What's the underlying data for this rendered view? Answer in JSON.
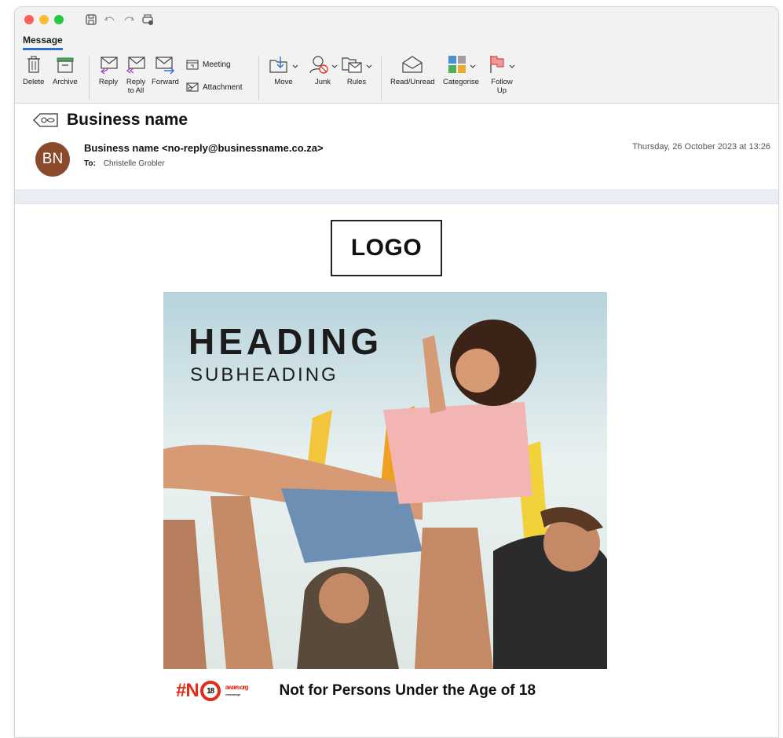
{
  "ribbon": {
    "tab": "Message",
    "delete": "Delete",
    "archive": "Archive",
    "reply": "Reply",
    "reply_all_1": "Reply",
    "reply_all_2": "to All",
    "forward": "Forward",
    "meeting": "Meeting",
    "attachment": "Attachment",
    "move": "Move",
    "junk": "Junk",
    "rules": "Rules",
    "read_unread": "Read/Unread",
    "categorise": "Categorise",
    "follow_1": "Follow",
    "follow_2": "Up"
  },
  "email": {
    "subject": "Business name",
    "avatar_initials": "BN",
    "from": "Business name <no-reply@businessname.co.za>",
    "to_label": "To:",
    "to": "Christelle Grobler",
    "date": "Thursday, 26 October 2023 at 13:26"
  },
  "content": {
    "logo": "LOGO",
    "heading": "HEADING",
    "subheading": "SUBHEADING",
    "age_tag": "#N",
    "age_number": "18",
    "aware_org": "aware.org",
    "aware_url": "www.aware.org.za",
    "notice": "Not for Persons Under the Age of 18"
  },
  "colors": {
    "accent": "#2f6fd1",
    "avatar": "#8a4a2b",
    "age_red": "#e22b1a"
  }
}
